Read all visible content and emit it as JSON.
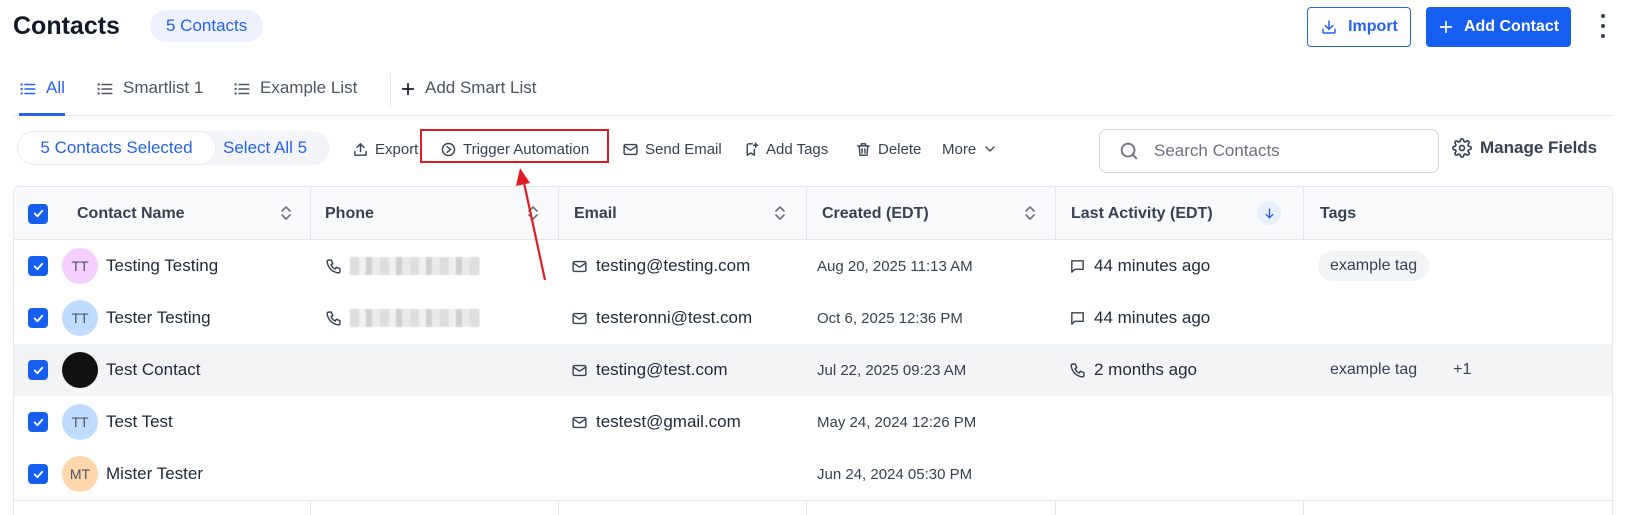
{
  "header": {
    "title": "Contacts",
    "count_badge": "5 Contacts",
    "import_label": "Import",
    "add_contact_label": "Add Contact"
  },
  "tabs": [
    {
      "label": "All",
      "active": true
    },
    {
      "label": "Smartlist 1",
      "active": false
    },
    {
      "label": "Example List",
      "active": false
    }
  ],
  "add_smart_list_label": "Add Smart List",
  "toolbar": {
    "selected_label": "5 Contacts Selected",
    "select_all_label": "Select All 5",
    "export_label": "Export",
    "trigger_automation_label": "Trigger Automation",
    "send_email_label": "Send Email",
    "add_tags_label": "Add Tags",
    "delete_label": "Delete",
    "more_label": "More",
    "search_placeholder": "Search Contacts",
    "manage_fields_label": "Manage Fields"
  },
  "table": {
    "columns": [
      "Contact Name",
      "Phone",
      "Email",
      "Created (EDT)",
      "Last Activity (EDT)",
      "Tags"
    ],
    "rows": [
      {
        "initials": "TT",
        "avatar_color": "#f5d0fe",
        "name": "Testing Testing",
        "has_phone": true,
        "email": "testing@testing.com",
        "created": "Aug 20, 2025 11:13 AM",
        "activity_icon": "chat-icon",
        "activity": "44 minutes ago",
        "tag": "example tag",
        "tag_extra": ""
      },
      {
        "initials": "TT",
        "avatar_color": "#bfdbfe",
        "name": "Tester Testing",
        "has_phone": true,
        "email": "testeronni@test.com",
        "created": "Oct 6, 2025 12:36 PM",
        "activity_icon": "chat-icon",
        "activity": "44 minutes ago",
        "tag": "",
        "tag_extra": ""
      },
      {
        "initials": "",
        "avatar_color": "#111111",
        "name": "Test Contact",
        "has_phone": false,
        "email": "testing@test.com",
        "created": "Jul 22, 2025 09:23 AM",
        "activity_icon": "phone-icon",
        "activity": "2 months ago",
        "tag": "example tag",
        "tag_extra": "+1"
      },
      {
        "initials": "TT",
        "avatar_color": "#bfdbfe",
        "name": "Test Test",
        "has_phone": false,
        "email": "testest@gmail.com",
        "created": "May 24, 2024 12:26 PM",
        "activity_icon": "",
        "activity": "",
        "tag": "",
        "tag_extra": ""
      },
      {
        "initials": "MT",
        "avatar_color": "#fed7aa",
        "name": "Mister Tester",
        "has_phone": false,
        "email": "",
        "created": "Jun 24, 2024 05:30 PM",
        "activity_icon": "",
        "activity": "",
        "tag": "",
        "tag_extra": ""
      }
    ]
  },
  "colors": {
    "accent": "#155eef",
    "highlight_box": "#e11d24",
    "annotation_arrow": "#e11d24"
  }
}
